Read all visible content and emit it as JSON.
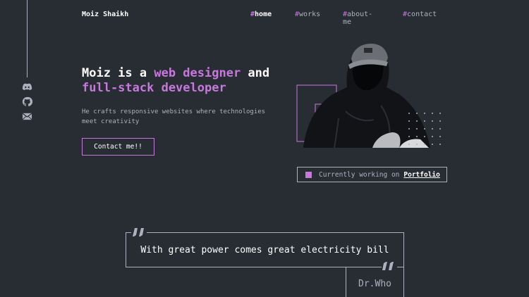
{
  "header": {
    "logo": "Moiz Shaikh",
    "nav": [
      {
        "hash": "#",
        "label": "home"
      },
      {
        "hash": "#",
        "label": "works"
      },
      {
        "hash": "#",
        "label": "about-me"
      },
      {
        "hash": "#",
        "label": "contact"
      }
    ]
  },
  "sidebar": {
    "icons": [
      "discord-icon",
      "github-icon",
      "email-icon"
    ]
  },
  "hero": {
    "line1_prefix": "Moiz is a ",
    "line1_accent": "web designer",
    "line1_suffix": " and",
    "line2_accent": "full-stack developer",
    "subtext": "He crafts responsive websites where technologies meet creativity",
    "cta_label": "Contact me!!"
  },
  "status": {
    "prefix": "Currently working on",
    "project": "Portfolio"
  },
  "quote": {
    "text": "With great power comes great electricity bill",
    "author": "Dr.Who"
  },
  "colors": {
    "background": "#282c33",
    "accent": "#c778dd",
    "muted": "#abb2bf",
    "text": "#ffffff"
  }
}
